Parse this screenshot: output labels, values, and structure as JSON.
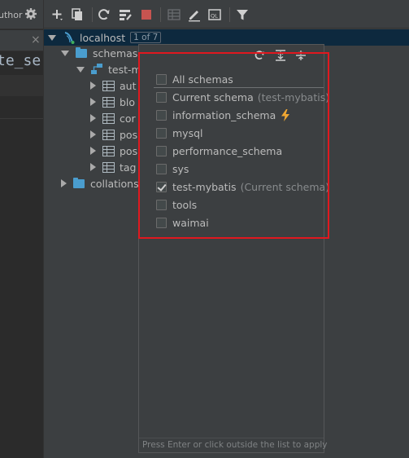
{
  "left_pane": {
    "author_text": "uthor",
    "code_text": "te_se",
    "close_glyph": "×"
  },
  "toolbar": {
    "icons": [
      "add-icon",
      "duplicate-icon",
      "refresh-icon",
      "settings-icon",
      "stop-icon",
      "table-icon",
      "edit-icon",
      "console-icon",
      "filter-icon"
    ]
  },
  "tree": {
    "root": {
      "label": "localhost",
      "badge": "1 of 7"
    },
    "schemas": {
      "label": "schemas"
    },
    "schema": {
      "label": "test-m"
    },
    "tables": [
      {
        "label": "aut"
      },
      {
        "label": "blo"
      },
      {
        "label": "cor"
      },
      {
        "label": "pos"
      },
      {
        "label": "pos"
      },
      {
        "label": "tag"
      }
    ],
    "collations": {
      "label": "collations"
    }
  },
  "popup": {
    "all_label": "All schemas",
    "options": [
      {
        "label": "Current schema",
        "hint": "(test-mybatis)",
        "checked": false
      },
      {
        "label": "information_schema",
        "hint": "",
        "checked": false,
        "bolt": true
      },
      {
        "label": "mysql",
        "hint": "",
        "checked": false
      },
      {
        "label": "performance_schema",
        "hint": "",
        "checked": false
      },
      {
        "label": "sys",
        "hint": "",
        "checked": false
      },
      {
        "label": "test-mybatis",
        "hint": "(Current schema)",
        "checked": true
      },
      {
        "label": "tools",
        "hint": "",
        "checked": false
      },
      {
        "label": "waimai",
        "hint": "",
        "checked": false
      }
    ],
    "footer": "Press Enter or click outside the list to apply"
  },
  "colors": {
    "highlight": "#e0181f",
    "selection": "#0d293e",
    "folder": "#4a9dce",
    "stop": "#c75450",
    "bolt": "#f0a732"
  }
}
